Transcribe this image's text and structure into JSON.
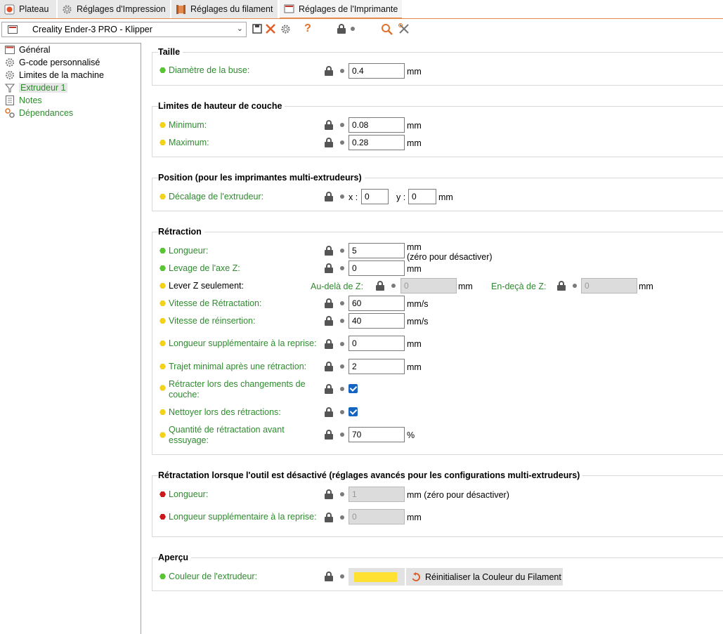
{
  "tabs": [
    {
      "label": "Plateau"
    },
    {
      "label": "Réglages d'Impression"
    },
    {
      "label": "Réglages du filament"
    },
    {
      "label": "Réglages de l'Imprimante"
    }
  ],
  "preset": {
    "value": "Creality Ender-3 PRO - Klipper"
  },
  "toolbar": {
    "help": "?"
  },
  "sidebar": [
    {
      "label": "Général",
      "icon": "printer-icon"
    },
    {
      "label": "G-code personnalisé",
      "icon": "gear-icon"
    },
    {
      "label": "Limites de la machine",
      "icon": "gear-icon"
    },
    {
      "label": "Extrudeur 1",
      "icon": "funnel-icon"
    },
    {
      "label": "Notes",
      "icon": "note-icon"
    },
    {
      "label": "Dépendances",
      "icon": "wrench-icon"
    }
  ],
  "sections": {
    "taille": {
      "title": "Taille",
      "nozzle": {
        "label": "Diamètre de la buse:",
        "value": "0.4",
        "unit": "mm"
      }
    },
    "layer": {
      "title": "Limites de hauteur de couche",
      "min": {
        "label": "Minimum:",
        "value": "0.08",
        "unit": "mm"
      },
      "max": {
        "label": "Maximum:",
        "value": "0.28",
        "unit": "mm"
      }
    },
    "position": {
      "title": "Position (pour les imprimantes multi-extrudeurs)",
      "offset": {
        "label": "Décalage de l'extrudeur:",
        "x_label": "x :",
        "x": "0",
        "y_label": "y :",
        "y": "0",
        "unit": "mm"
      }
    },
    "retraction": {
      "title": "Rétraction",
      "length": {
        "label": "Longueur:",
        "value": "5",
        "unit": "mm",
        "note": "(zéro pour désactiver)"
      },
      "lift": {
        "label": "Levage de l'axe Z:",
        "value": "0",
        "unit": "mm"
      },
      "only_lift": {
        "label": "Lever Z seulement:",
        "above_label": "Au-delà de Z:",
        "above": "0",
        "above_unit": "mm",
        "below_label": "En-deçà de Z:",
        "below": "0",
        "below_unit": "mm"
      },
      "speed": {
        "label": "Vitesse de Rétractation:",
        "value": "60",
        "unit": "mm/s"
      },
      "deretract": {
        "label": "Vitesse de réinsertion:",
        "value": "40",
        "unit": "mm/s"
      },
      "extra": {
        "label": "Longueur supplémentaire à la reprise:",
        "value": "0",
        "unit": "mm"
      },
      "min_travel": {
        "label": "Trajet minimal après une rétraction:",
        "value": "2",
        "unit": "mm"
      },
      "layer_change": {
        "label_1": "Rétracter lors des changements de",
        "label_2": "couche:",
        "checked": true
      },
      "wipe": {
        "label": "Nettoyer lors des rétractions:",
        "checked": true
      },
      "before_wipe": {
        "label_1": "Quantité de rétractation avant",
        "label_2": "essuyage:",
        "value": "70",
        "unit": "%"
      }
    },
    "toolchange": {
      "title": "Rétractation lorsque l'outil est désactivé (réglages avancés pour les configurations multi-extrudeurs)",
      "length": {
        "label": "Longueur:",
        "value": "1",
        "unit": "mm (zéro pour désactiver)"
      },
      "extra": {
        "label": "Longueur supplémentaire à la reprise:",
        "value": "0",
        "unit": "mm"
      }
    },
    "preview": {
      "title": "Aperçu",
      "color": {
        "label": "Couleur de l'extrudeur:",
        "value": "#ffe134",
        "reset_label": "Réinitialiser la Couleur du Filament"
      }
    }
  }
}
